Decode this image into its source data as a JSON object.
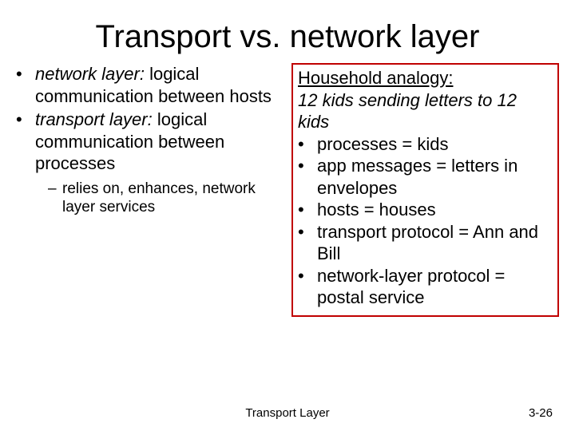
{
  "title": "Transport vs. network layer",
  "left": {
    "items": [
      {
        "term": "network layer:",
        "rest": " logical communication between hosts"
      },
      {
        "term": "transport layer:",
        "rest": " logical communication between processes"
      }
    ],
    "sub": "relies on, enhances, network layer services"
  },
  "right": {
    "heading": "Household analogy:",
    "intro": "12 kids sending letters to 12 kids",
    "items": [
      "processes = kids",
      "app messages = letters in envelopes",
      "hosts = houses",
      "transport protocol = Ann and Bill",
      "network-layer protocol = postal service"
    ]
  },
  "footer": {
    "center": "Transport Layer",
    "right": "3-26"
  }
}
